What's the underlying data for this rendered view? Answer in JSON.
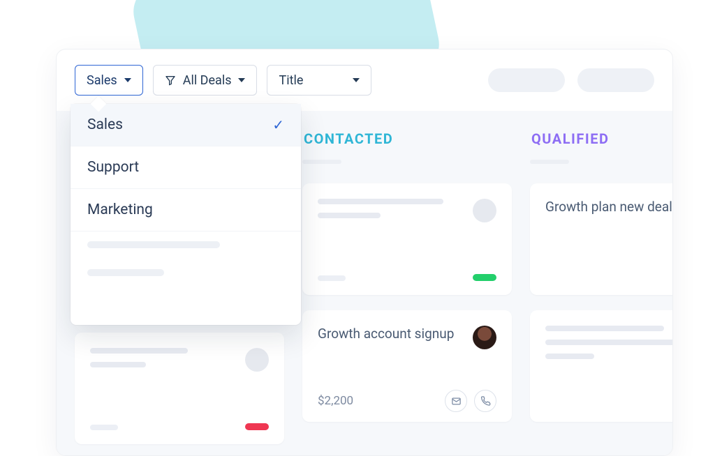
{
  "toolbar": {
    "pipeline_label": "Sales",
    "filter_label": "All Deals",
    "sort_label": "Title"
  },
  "dropdown": {
    "items": [
      {
        "label": "Sales",
        "selected": true
      },
      {
        "label": "Support",
        "selected": false
      },
      {
        "label": "Marketing",
        "selected": false
      }
    ]
  },
  "board": {
    "columns": [
      {
        "key": "contacted",
        "label": "CONTACTED"
      },
      {
        "key": "qualified",
        "label": "QUALIFIED"
      }
    ]
  },
  "cards": {
    "growth_signup": {
      "title": "Growth account signup",
      "price": "$2,200"
    },
    "growth_plan": {
      "title": "Growth plan new deal"
    }
  },
  "icons": {
    "funnel": "funnel-icon",
    "caret": "caret-down-icon",
    "check": "check-icon",
    "mail": "mail-icon",
    "phone": "phone-icon"
  }
}
